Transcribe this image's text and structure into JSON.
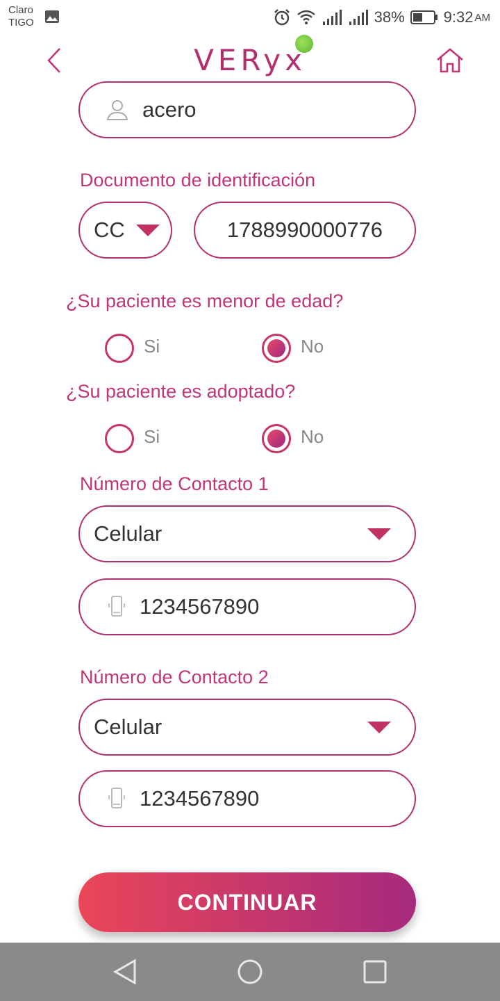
{
  "status_bar": {
    "carrier_line1": "Claro",
    "carrier_line2": "TIGO",
    "battery": "38%",
    "time": "9:32",
    "ampm": "AM"
  },
  "header": {
    "logo": "VERyx",
    "back_icon": "chevron-left-icon",
    "home_icon": "home-icon"
  },
  "form": {
    "name_value": "acero",
    "document_label": "Documento de identificación",
    "doc_type": "CC",
    "doc_number": "1788990000776",
    "minor_question": "¿Su paciente es menor de edad?",
    "minor_yes": "Si",
    "minor_no": "No",
    "minor_selected": "No",
    "adopted_question": "¿Su paciente es adoptado?",
    "adopted_yes": "Si",
    "adopted_no": "No",
    "adopted_selected": "No",
    "contact1_label": "Número de Contacto 1",
    "contact1_type": "Celular",
    "contact1_number": "1234567890",
    "contact2_label": "Número de Contacto 2",
    "contact2_type": "Celular",
    "contact2_number": "1234567890"
  },
  "continue_label": "CONTINUAR",
  "colors": {
    "accent": "#b3306f",
    "button_start": "#ea4658",
    "button_end": "#a62a7e"
  }
}
